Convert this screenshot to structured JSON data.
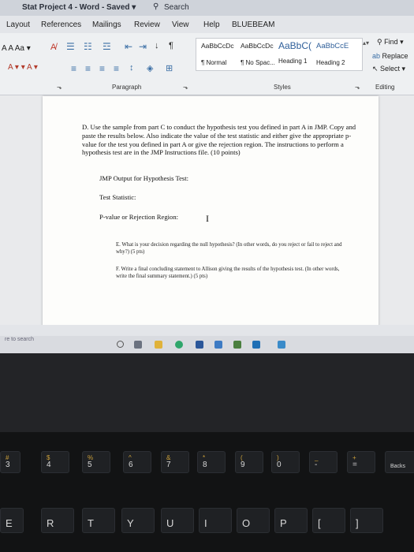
{
  "titlebar": {
    "doc_title": "Stat Project 4  -  Word  -  Saved  ▾",
    "search_label": "Search"
  },
  "tabs": [
    "Layout",
    "References",
    "Mailings",
    "Review",
    "View",
    "Help",
    "BLUEBEAM"
  ],
  "ribbon": {
    "font_row1": "A  A   Aa ▾",
    "font_row2": "A ▾   ▾  A ▾",
    "styles": [
      {
        "preview": "AaBbCcDc",
        "name": "¶ Normal"
      },
      {
        "preview": "AaBbCcDc",
        "name": "¶ No Spac..."
      },
      {
        "preview": "AaBbC(",
        "name": "Heading 1"
      },
      {
        "preview": "AaBbCcE",
        "name": "Heading 2"
      }
    ],
    "editing": {
      "find": "Find ▾",
      "replace": "Replace",
      "select": "Select ▾"
    },
    "groups": {
      "paragraph": "Paragraph",
      "styles": "Styles",
      "editing": "Editing"
    }
  },
  "document": {
    "question_d": "D. Use the sample from part C to conduct the hypothesis test you defined in part A in JMP. Copy and paste the results below. Also indicate the value of the test statistic and either give the appropriate p-value for the test you defined in part A or give the rejection region. The instructions to perform a hypothesis test are in the JMP Instructions file. (10 points)",
    "jmp_output": "JMP Output for Hypothesis Test:",
    "test_statistic": "Test Statistic:",
    "pvalue": "P-value or Rejection Region:",
    "question_e": "E. What is your decision regarding the null hypothesis? (In other words, do you reject or fail to reject and why?) (5 pts)",
    "question_f": "F. Write a final concluding statement to Allison giving the results of the hypothesis test. (In other words, write the final summary statement.) (5 pts)"
  },
  "taskbar": {
    "search_placeholder": "re to search"
  },
  "keyboard": {
    "row_numbers": [
      {
        "main": "3",
        "sub": "#"
      },
      {
        "main": "4",
        "sub": "$"
      },
      {
        "main": "5",
        "sub": "%"
      },
      {
        "main": "6",
        "sub": "^"
      },
      {
        "main": "7",
        "sub": "&"
      },
      {
        "main": "8",
        "sub": "*"
      },
      {
        "main": "9",
        "sub": "("
      },
      {
        "main": "0",
        "sub": ")"
      },
      {
        "main": "-",
        "sub": "_"
      },
      {
        "main": "=",
        "sub": "+"
      },
      {
        "main": "Backs",
        "sub": ""
      }
    ],
    "row_letters": [
      "E",
      "R",
      "T",
      "Y",
      "U",
      "I",
      "O",
      "P",
      "[",
      "]"
    ]
  }
}
